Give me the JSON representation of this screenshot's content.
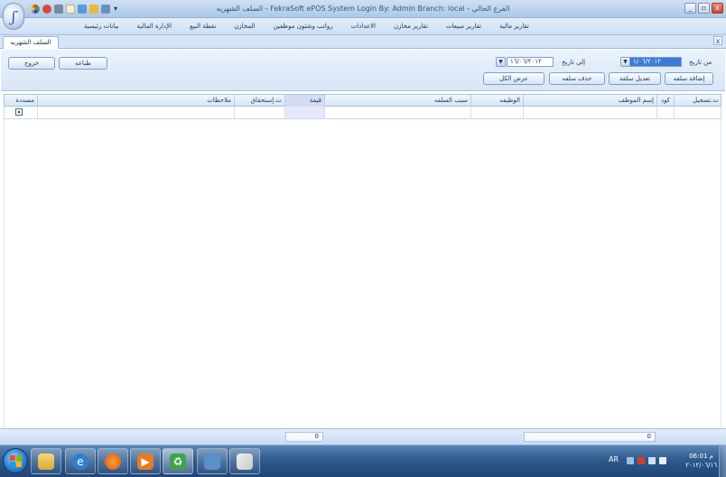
{
  "window": {
    "title": "السلف الشهريه - FekraSoft ePOS System   Login By: Admin   Branch: local - الفرع الحالي",
    "controls": {
      "minimize": "_",
      "restore": "▫",
      "close": "x"
    }
  },
  "menu": {
    "items": [
      "تقارير مالية",
      "تقارير مبيعات",
      "تقارير مخازن",
      "الاعدادات",
      "رواتب وشئون موظفين",
      "المخازن",
      "نقطة البيع",
      "الإدارة المالية",
      "بيانات رئيسية"
    ]
  },
  "tab": {
    "label": "السلف الشهريه",
    "close": "x"
  },
  "filters": {
    "from_label": "من تاريخ",
    "from_value": "١/٠٦/٢٠١٢",
    "to_label": "إلي تاريخ",
    "to_value": "١٦/٠٦/٢٠١٢",
    "dropdown_glyph": "▼"
  },
  "actions": {
    "add": "إضافة سلفه",
    "edit": "تعديل سلفة",
    "delete": "حذف سلفه",
    "show_all": "عرض الكل",
    "print": "طباعه",
    "exit": "خروج"
  },
  "grid": {
    "columns": [
      "ت.تسجيل",
      "كود",
      "إسم الموظف",
      "الوظيفه",
      "سبب السلفه",
      "قيمة",
      "ت.إستحقاق",
      "ملاحظات",
      "مسددة"
    ]
  },
  "status": {
    "total_left": "0",
    "total_right": "0"
  },
  "taskbar": {
    "apps": [
      "folder-icon",
      "ie-icon",
      "firefox-icon",
      "media-player-icon",
      "recycle-app-icon",
      "remote-desktop-icon",
      "paint-icon"
    ],
    "lang": "AR",
    "time": "06:01 م",
    "date": "٢٠١٢/٠٦/١٦"
  }
}
